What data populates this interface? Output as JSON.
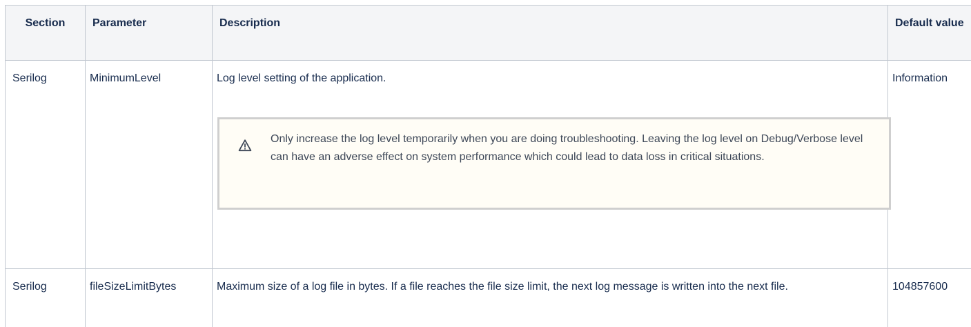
{
  "table": {
    "headers": {
      "section": "Section",
      "parameter": "Parameter",
      "description": "Description",
      "default_value": "Default value"
    },
    "rows": [
      {
        "section": "Serilog",
        "parameter": "MinimumLevel",
        "description": "Log level setting of the application.",
        "note": {
          "icon": "warning-icon",
          "text": "Only increase the log level temporarily when you are doing troubleshooting. Leaving the log level on Debug/Verbose level can have an adverse effect on system performance which could lead to data loss in critical situations."
        },
        "default_value": "Information"
      },
      {
        "section": "Serilog",
        "parameter": "fileSizeLimitBytes",
        "description": "Maximum size of a log file in bytes. If a file reaches the file size limit, the next log message is written into the next file.",
        "default_value": "104857600"
      }
    ]
  }
}
